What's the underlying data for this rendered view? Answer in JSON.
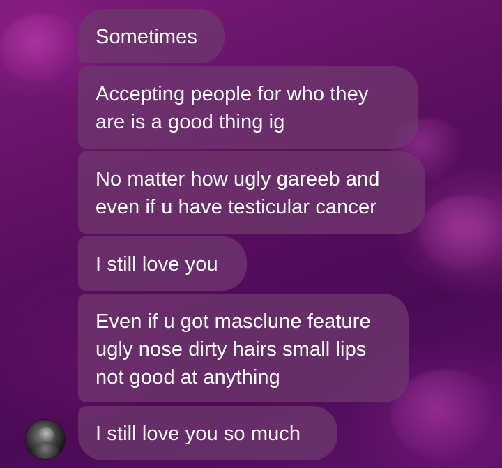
{
  "chat": {
    "messages": [
      {
        "text": "Sometimes"
      },
      {
        "text": "Accepting people for who they\nare is a good thing ig"
      },
      {
        "text": "No matter how ugly gareeb and\neven if u have testicular cancer"
      },
      {
        "text": "I still love you"
      },
      {
        "text": "Even if u got masclune feature\nugly nose dirty hairs small lips\nnot good at anything"
      },
      {
        "text": "I still love you so much"
      }
    ]
  },
  "theme": {
    "bubble_color": "#6e376e",
    "background_color": "#5a0f5f",
    "text_color": "#ffffff"
  }
}
